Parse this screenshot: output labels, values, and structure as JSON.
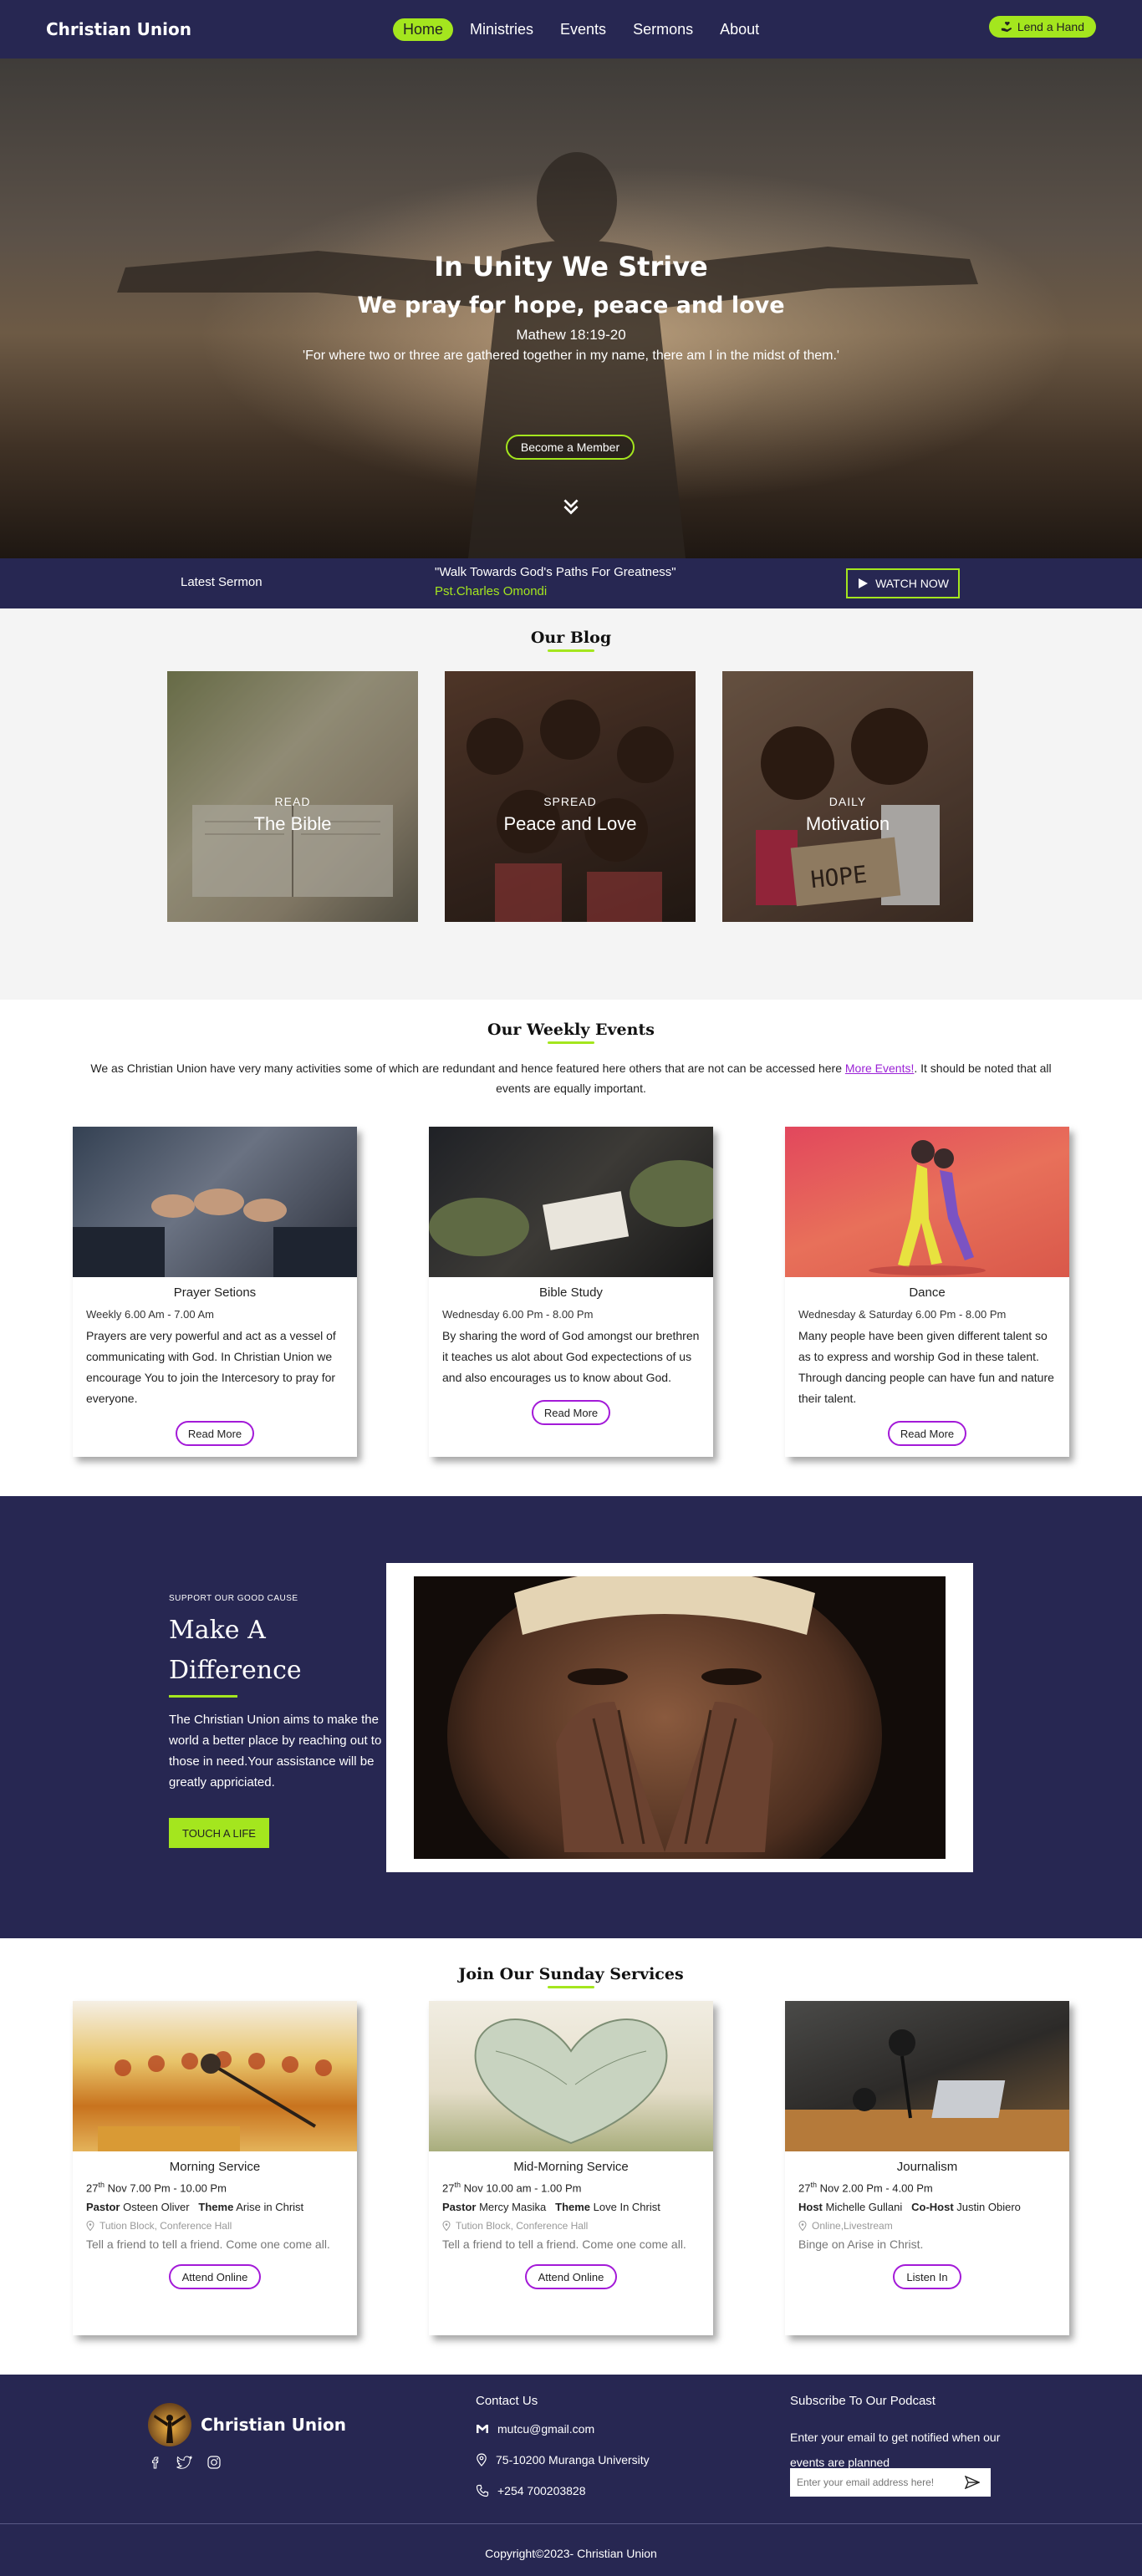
{
  "nav": {
    "brand": "Christian Union",
    "links": [
      "Home",
      "Ministries",
      "Events",
      "Sermons",
      "About"
    ],
    "lend_label": "Lend a Hand"
  },
  "hero": {
    "title": "In Unity We Strive",
    "subtitle": "We pray for hope, peace and love",
    "verse_ref": "Mathew 18:19-20",
    "verse": "'For where two or three are gathered together in my name, there am I in the midst of them.'",
    "cta": "Become a Member"
  },
  "sermon": {
    "label": "Latest Sermon",
    "title": "\"Walk Towards God's Paths For Greatness\"",
    "pastor": "Pst.Charles Omondi",
    "watch": "WATCH NOW"
  },
  "blog": {
    "title": "Our Blog",
    "cards": [
      {
        "kicker": "READ",
        "name": "The Bible"
      },
      {
        "kicker": "SPREAD",
        "name": "Peace and Love"
      },
      {
        "kicker": "DAILY",
        "name": "Motivation"
      }
    ],
    "sign_text": "HOPE"
  },
  "events": {
    "title": "Our Weekly Events",
    "intro_before": "We as Christian Union have very many activities some of which are redundant and hence featured here others that are not can be accessed here ",
    "intro_link": "More Events!",
    "intro_after": ". It should be noted that all events are equally important.",
    "cards": [
      {
        "title": "Prayer Setions",
        "time": "Weekly 6.00 Am - 7.00 Am",
        "desc": "Prayers are very powerful and act as a vessel of communicating with God. In Christian Union we encourage You to join the Intercesory to pray for everyone.",
        "button": "Read More"
      },
      {
        "title": "Bible Study",
        "time": "Wednesday 6.00 Pm - 8.00 Pm",
        "desc": "By sharing the word of God amongst our brethren it teaches us alot about God expectections of us and also encourages us to know about God.",
        "button": "Read More"
      },
      {
        "title": "Dance",
        "time": "Wednesday & Saturday 6.00 Pm - 8.00 Pm",
        "desc": "Many people have been given different talent so as to express and worship God in these talent. Through dancing people can have fun and nature their talent.",
        "button": "Read More"
      }
    ]
  },
  "difference": {
    "kicker": "SUPPORT OUR GOOD CAUSE",
    "title_line1": "Make A",
    "title_line2": "Difference",
    "text": "The Christian Union aims to make the world a better place by reaching out to those in need.Your assistance will be greatly appriciated.",
    "button": "TOUCH A LIFE"
  },
  "services": {
    "title": "Join Our Sunday Services",
    "cards": [
      {
        "title": "Morning Service",
        "day": "27",
        "sup": "th",
        "rest": " Nov 7.00 Pm - 10.00 Pm",
        "role1": "Pastor",
        "val1": "Osteen Oliver",
        "role2": "Theme",
        "val2": "Arise in Christ",
        "location": "Tution Block, Conference Hall",
        "desc": "Tell a friend to tell a friend. Come one come all.",
        "button": "Attend Online"
      },
      {
        "title": "Mid-Morning Service",
        "day": "27",
        "sup": "th",
        "rest": " Nov 10.00 am - 1.00 Pm",
        "role1": "Pastor",
        "val1": "Mercy Masika",
        "role2": "Theme",
        "val2": "Love In Christ",
        "location": "Tution Block, Conference Hall",
        "desc": "Tell a friend to tell a friend. Come one come all.",
        "button": "Attend Online"
      },
      {
        "title": "Journalism",
        "day": "27",
        "sup": "th",
        "rest": " Nov 2.00 Pm - 4.00 Pm",
        "role1": "Host",
        "val1": "Michelle Gullani",
        "role2": "Co-Host",
        "val2": "Justin Obiero",
        "location": "Online,Livestream",
        "desc": "Binge on Arise in Christ.",
        "button": "Listen In"
      }
    ]
  },
  "footer": {
    "brand": "Christian Union",
    "contact_title": "Contact Us",
    "email": "mutcu@gmail.com",
    "address": "75-10200 Muranga University",
    "phone": "+254 700203828",
    "podcast_title": "Subscribe To Our Podcast",
    "podcast_text": "Enter your email to get notified when our events are planned",
    "email_placeholder": "Enter your email address here!",
    "copyright": "Copyright©2023- Christian Union"
  }
}
